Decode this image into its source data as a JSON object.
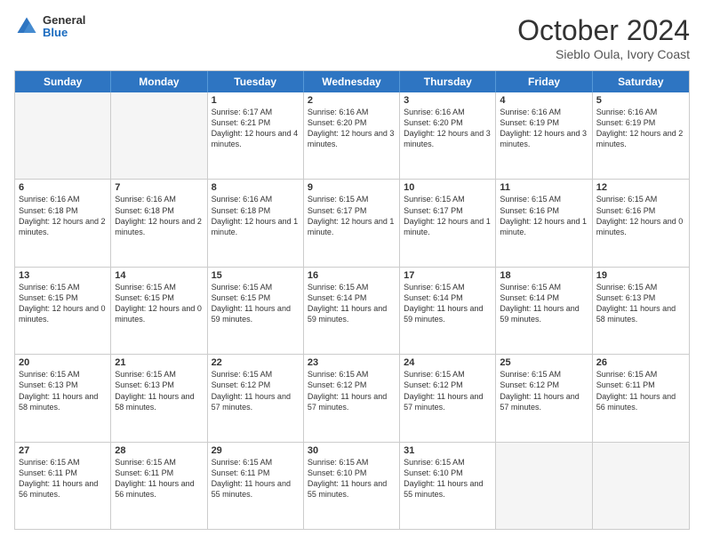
{
  "header": {
    "logo_line1": "General",
    "logo_line2": "Blue",
    "month_title": "October 2024",
    "subtitle": "Sieblo Oula, Ivory Coast"
  },
  "days_of_week": [
    "Sunday",
    "Monday",
    "Tuesday",
    "Wednesday",
    "Thursday",
    "Friday",
    "Saturday"
  ],
  "weeks": [
    [
      {
        "day": "",
        "info": "",
        "empty": true
      },
      {
        "day": "",
        "info": "",
        "empty": true
      },
      {
        "day": "1",
        "info": "Sunrise: 6:17 AM\nSunset: 6:21 PM\nDaylight: 12 hours and 4 minutes."
      },
      {
        "day": "2",
        "info": "Sunrise: 6:16 AM\nSunset: 6:20 PM\nDaylight: 12 hours and 3 minutes."
      },
      {
        "day": "3",
        "info": "Sunrise: 6:16 AM\nSunset: 6:20 PM\nDaylight: 12 hours and 3 minutes."
      },
      {
        "day": "4",
        "info": "Sunrise: 6:16 AM\nSunset: 6:19 PM\nDaylight: 12 hours and 3 minutes."
      },
      {
        "day": "5",
        "info": "Sunrise: 6:16 AM\nSunset: 6:19 PM\nDaylight: 12 hours and 2 minutes."
      }
    ],
    [
      {
        "day": "6",
        "info": "Sunrise: 6:16 AM\nSunset: 6:18 PM\nDaylight: 12 hours and 2 minutes."
      },
      {
        "day": "7",
        "info": "Sunrise: 6:16 AM\nSunset: 6:18 PM\nDaylight: 12 hours and 2 minutes."
      },
      {
        "day": "8",
        "info": "Sunrise: 6:16 AM\nSunset: 6:18 PM\nDaylight: 12 hours and 1 minute."
      },
      {
        "day": "9",
        "info": "Sunrise: 6:15 AM\nSunset: 6:17 PM\nDaylight: 12 hours and 1 minute."
      },
      {
        "day": "10",
        "info": "Sunrise: 6:15 AM\nSunset: 6:17 PM\nDaylight: 12 hours and 1 minute."
      },
      {
        "day": "11",
        "info": "Sunrise: 6:15 AM\nSunset: 6:16 PM\nDaylight: 12 hours and 1 minute."
      },
      {
        "day": "12",
        "info": "Sunrise: 6:15 AM\nSunset: 6:16 PM\nDaylight: 12 hours and 0 minutes."
      }
    ],
    [
      {
        "day": "13",
        "info": "Sunrise: 6:15 AM\nSunset: 6:15 PM\nDaylight: 12 hours and 0 minutes."
      },
      {
        "day": "14",
        "info": "Sunrise: 6:15 AM\nSunset: 6:15 PM\nDaylight: 12 hours and 0 minutes."
      },
      {
        "day": "15",
        "info": "Sunrise: 6:15 AM\nSunset: 6:15 PM\nDaylight: 11 hours and 59 minutes."
      },
      {
        "day": "16",
        "info": "Sunrise: 6:15 AM\nSunset: 6:14 PM\nDaylight: 11 hours and 59 minutes."
      },
      {
        "day": "17",
        "info": "Sunrise: 6:15 AM\nSunset: 6:14 PM\nDaylight: 11 hours and 59 minutes."
      },
      {
        "day": "18",
        "info": "Sunrise: 6:15 AM\nSunset: 6:14 PM\nDaylight: 11 hours and 59 minutes."
      },
      {
        "day": "19",
        "info": "Sunrise: 6:15 AM\nSunset: 6:13 PM\nDaylight: 11 hours and 58 minutes."
      }
    ],
    [
      {
        "day": "20",
        "info": "Sunrise: 6:15 AM\nSunset: 6:13 PM\nDaylight: 11 hours and 58 minutes."
      },
      {
        "day": "21",
        "info": "Sunrise: 6:15 AM\nSunset: 6:13 PM\nDaylight: 11 hours and 58 minutes."
      },
      {
        "day": "22",
        "info": "Sunrise: 6:15 AM\nSunset: 6:12 PM\nDaylight: 11 hours and 57 minutes."
      },
      {
        "day": "23",
        "info": "Sunrise: 6:15 AM\nSunset: 6:12 PM\nDaylight: 11 hours and 57 minutes."
      },
      {
        "day": "24",
        "info": "Sunrise: 6:15 AM\nSunset: 6:12 PM\nDaylight: 11 hours and 57 minutes."
      },
      {
        "day": "25",
        "info": "Sunrise: 6:15 AM\nSunset: 6:12 PM\nDaylight: 11 hours and 57 minutes."
      },
      {
        "day": "26",
        "info": "Sunrise: 6:15 AM\nSunset: 6:11 PM\nDaylight: 11 hours and 56 minutes."
      }
    ],
    [
      {
        "day": "27",
        "info": "Sunrise: 6:15 AM\nSunset: 6:11 PM\nDaylight: 11 hours and 56 minutes."
      },
      {
        "day": "28",
        "info": "Sunrise: 6:15 AM\nSunset: 6:11 PM\nDaylight: 11 hours and 56 minutes."
      },
      {
        "day": "29",
        "info": "Sunrise: 6:15 AM\nSunset: 6:11 PM\nDaylight: 11 hours and 55 minutes."
      },
      {
        "day": "30",
        "info": "Sunrise: 6:15 AM\nSunset: 6:10 PM\nDaylight: 11 hours and 55 minutes."
      },
      {
        "day": "31",
        "info": "Sunrise: 6:15 AM\nSunset: 6:10 PM\nDaylight: 11 hours and 55 minutes."
      },
      {
        "day": "",
        "info": "",
        "empty": true
      },
      {
        "day": "",
        "info": "",
        "empty": true
      }
    ]
  ]
}
